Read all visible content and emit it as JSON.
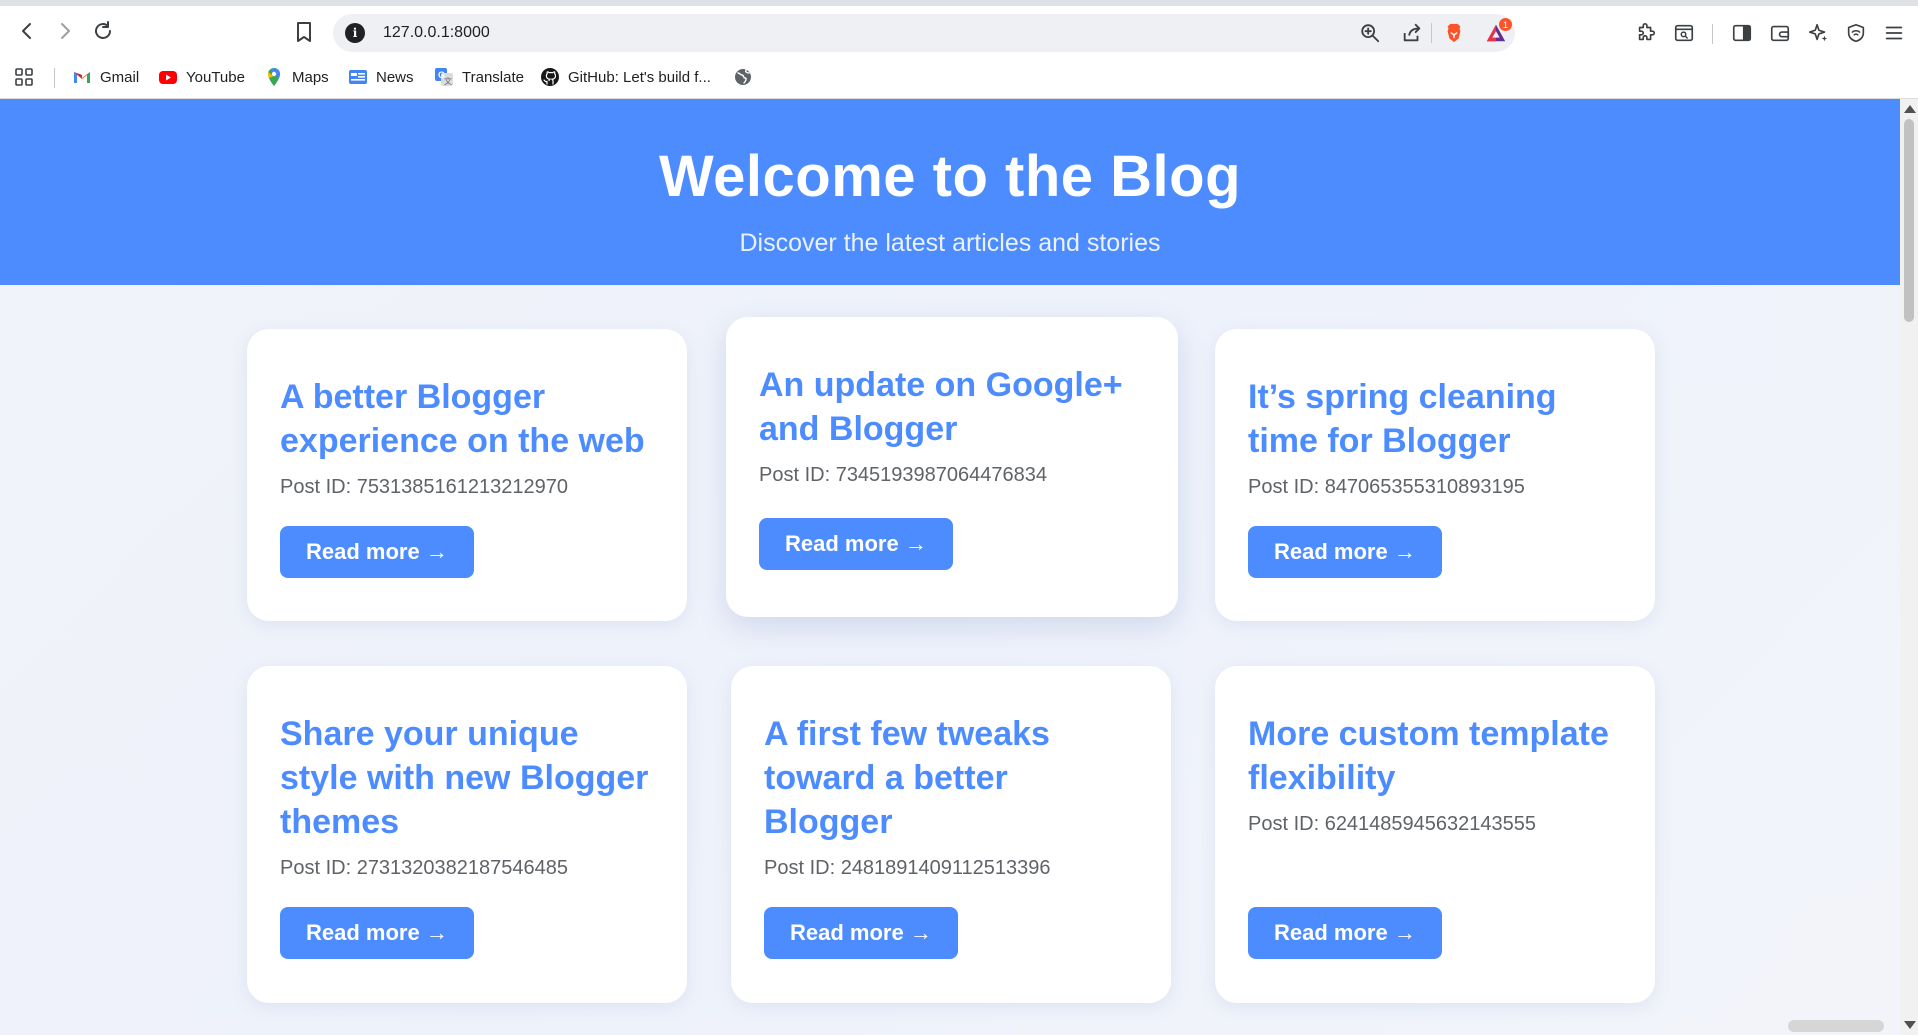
{
  "browser": {
    "url": "127.0.0.1:8000",
    "brave_badge_count": "1",
    "bookmarks": [
      {
        "label": "Gmail",
        "icon": "gmail-icon"
      },
      {
        "label": "YouTube",
        "icon": "youtube-icon"
      },
      {
        "label": "Maps",
        "icon": "maps-icon"
      },
      {
        "label": "News",
        "icon": "news-icon"
      },
      {
        "label": "Translate",
        "icon": "translate-icon"
      },
      {
        "label": "GitHub: Let's build f...",
        "icon": "github-icon"
      }
    ]
  },
  "hero": {
    "title": "Welcome to the Blog",
    "subtitle": "Discover the latest articles and stories",
    "color": "#4d8cff"
  },
  "posts": [
    {
      "title": "A better Blogger experience on the web",
      "post_id": "Post ID: 7531385161213212970",
      "button": "Read more →"
    },
    {
      "title": "An update on Google+ and Blogger",
      "post_id": "Post ID: 7345193987064476834",
      "button": "Read more →"
    },
    {
      "title": "It’s spring cleaning time for Blogger",
      "post_id": "Post ID: 847065355310893195",
      "button": "Read more →"
    },
    {
      "title": "Share your unique style with new Blogger themes",
      "post_id": "Post ID: 2731320382187546485",
      "button": "Read more →"
    },
    {
      "title": "A first few tweaks toward a better Blogger",
      "post_id": "Post ID: 2481891409112513396",
      "button": "Read more →"
    },
    {
      "title": "More custom template flexibility",
      "post_id": "Post ID: 6241485945632143555",
      "button": "Read more →"
    }
  ]
}
